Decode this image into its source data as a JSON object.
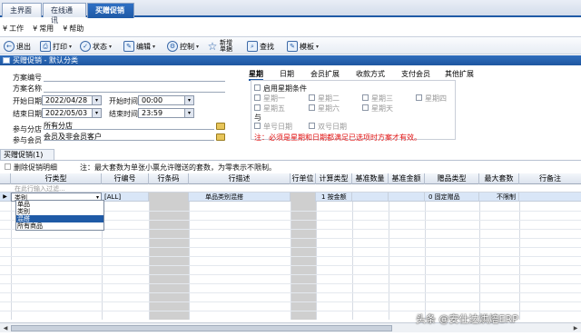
{
  "tabs": [
    {
      "label": "主界面"
    },
    {
      "label": "在线通讯"
    },
    {
      "label": "买赠促销"
    }
  ],
  "menu": [
    {
      "label": "工作"
    },
    {
      "label": "常用"
    },
    {
      "label": "帮助"
    }
  ],
  "toolbar": {
    "exit": "退出",
    "print": "打印",
    "status": "状态",
    "edit": "编辑",
    "control": "控制",
    "new_line1": "新增",
    "new_line2": "单据",
    "search": "查找",
    "template": "模板"
  },
  "form": {
    "header": "买赠促销 - 默认分类",
    "scheme_no_label": "方案编号",
    "scheme_name_label": "方案名称",
    "start_date_label": "开始日期",
    "start_date": "2022/04/28",
    "start_time_label": "开始时间",
    "start_time": "00:00",
    "end_date_label": "结束日期",
    "end_date": "2022/05/03",
    "end_time_label": "结束时间",
    "end_time": "23:59",
    "store_label": "参与分店",
    "store_value": "所有分店",
    "member_label": "参与会员",
    "member_value": "会员及非会员客户"
  },
  "right_tabs": [
    {
      "label": "星期"
    },
    {
      "label": "日期"
    },
    {
      "label": "会员扩展"
    },
    {
      "label": "收款方式"
    },
    {
      "label": "支付会员"
    },
    {
      "label": "其他扩展"
    }
  ],
  "week_panel": {
    "enable_label": "启用星期条件",
    "days": [
      "星期一",
      "星期二",
      "星期三",
      "星期四",
      "星期五",
      "星期六",
      "星期天"
    ],
    "and_label": "与",
    "single_label": "单号日期",
    "double_label": "双号日期",
    "note": "注：必须是星期和日期都满足已选项时方案才有效。"
  },
  "detail": {
    "subtab": "买赠促销(1)",
    "delete_label": "删除促销明细",
    "note": "注：最大套数为单张小票允许赠送的套数，为零表示不限制。"
  },
  "grid": {
    "columns": [
      "行类型",
      "行编号",
      "行条码",
      "行描述",
      "行单位",
      "计算类型",
      "基准数量",
      "基准金额",
      "赠品类型",
      "最大套数",
      "行备注"
    ],
    "filter_text": "在此行输入过滤...",
    "row": {
      "type": "类别",
      "code": "[ALL]",
      "desc": "单品类别混搭",
      "calc": "1 按金额",
      "gift_type": "0 固定赠品",
      "max_sets": "不限制"
    },
    "dropdown_options": [
      "单品",
      "类别",
      "混搭",
      "所有商品"
    ],
    "dropdown_selected": "混搭"
  },
  "watermark": "头条 @安仕达烘焙ERP"
}
